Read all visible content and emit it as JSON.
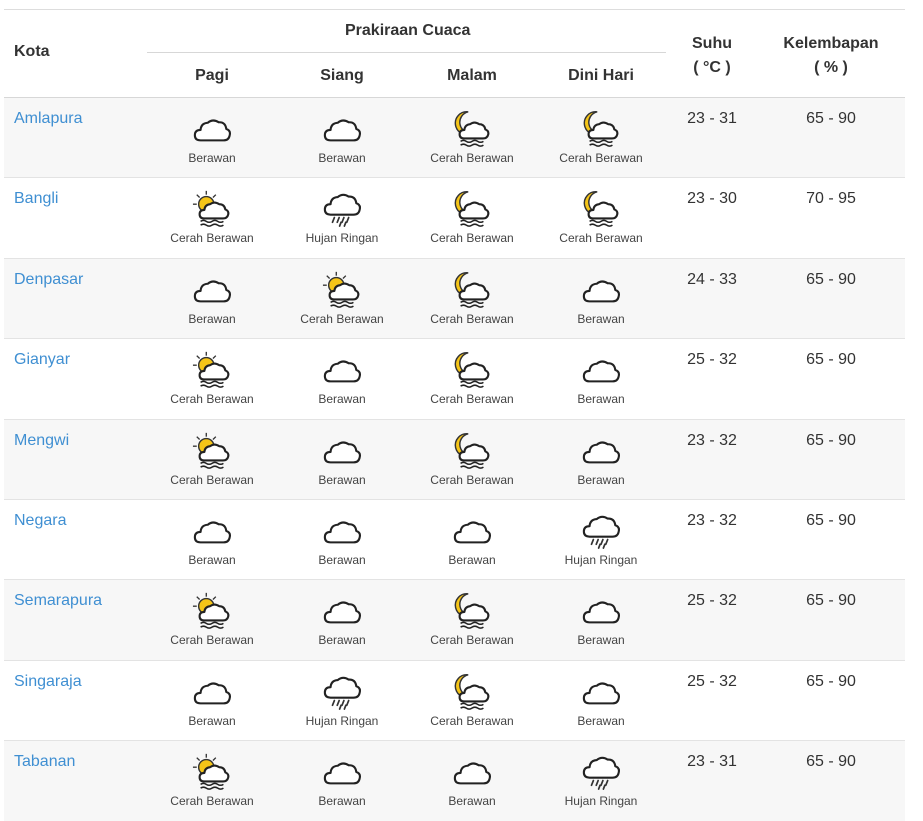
{
  "header": {
    "kota": "Kota",
    "prakiraan": "Prakiraan Cuaca",
    "periods": [
      "Pagi",
      "Siang",
      "Malam",
      "Dini Hari"
    ],
    "suhu": "Suhu",
    "suhu_unit": "( °C )",
    "kelembapan": "Kelembapan",
    "kelembapan_unit": "( % )"
  },
  "rows": [
    {
      "city": "Amlapura",
      "temp": "23 - 31",
      "hum": "65 - 90",
      "forecast": [
        {
          "label": "Berawan",
          "icon": "cloudy-icon"
        },
        {
          "label": "Berawan",
          "icon": "cloudy-icon"
        },
        {
          "label": "Cerah Berawan",
          "icon": "partly-cloudy-night-icon"
        },
        {
          "label": "Cerah Berawan",
          "icon": "partly-cloudy-night-icon"
        }
      ]
    },
    {
      "city": "Bangli",
      "temp": "23 - 30",
      "hum": "70 - 95",
      "forecast": [
        {
          "label": "Cerah Berawan",
          "icon": "partly-cloudy-day-icon"
        },
        {
          "label": "Hujan Ringan",
          "icon": "light-rain-icon"
        },
        {
          "label": "Cerah Berawan",
          "icon": "partly-cloudy-night-icon"
        },
        {
          "label": "Cerah Berawan",
          "icon": "partly-cloudy-night-icon"
        }
      ]
    },
    {
      "city": "Denpasar",
      "temp": "24 - 33",
      "hum": "65 - 90",
      "forecast": [
        {
          "label": "Berawan",
          "icon": "cloudy-icon"
        },
        {
          "label": "Cerah Berawan",
          "icon": "partly-cloudy-day-icon"
        },
        {
          "label": "Cerah Berawan",
          "icon": "partly-cloudy-night-icon"
        },
        {
          "label": "Berawan",
          "icon": "cloudy-icon"
        }
      ]
    },
    {
      "city": "Gianyar",
      "temp": "25 - 32",
      "hum": "65 - 90",
      "forecast": [
        {
          "label": "Cerah Berawan",
          "icon": "partly-cloudy-day-icon"
        },
        {
          "label": "Berawan",
          "icon": "cloudy-icon"
        },
        {
          "label": "Cerah Berawan",
          "icon": "partly-cloudy-night-icon"
        },
        {
          "label": "Berawan",
          "icon": "cloudy-icon"
        }
      ]
    },
    {
      "city": "Mengwi",
      "temp": "23 - 32",
      "hum": "65 - 90",
      "forecast": [
        {
          "label": "Cerah Berawan",
          "icon": "partly-cloudy-day-icon"
        },
        {
          "label": "Berawan",
          "icon": "cloudy-icon"
        },
        {
          "label": "Cerah Berawan",
          "icon": "partly-cloudy-night-icon"
        },
        {
          "label": "Berawan",
          "icon": "cloudy-icon"
        }
      ]
    },
    {
      "city": "Negara",
      "temp": "23 - 32",
      "hum": "65 - 90",
      "forecast": [
        {
          "label": "Berawan",
          "icon": "cloudy-icon"
        },
        {
          "label": "Berawan",
          "icon": "cloudy-icon"
        },
        {
          "label": "Berawan",
          "icon": "cloudy-icon"
        },
        {
          "label": "Hujan Ringan",
          "icon": "light-rain-icon"
        }
      ]
    },
    {
      "city": "Semarapura",
      "temp": "25 - 32",
      "hum": "65 - 90",
      "forecast": [
        {
          "label": "Cerah Berawan",
          "icon": "partly-cloudy-day-icon"
        },
        {
          "label": "Berawan",
          "icon": "cloudy-icon"
        },
        {
          "label": "Cerah Berawan",
          "icon": "partly-cloudy-night-icon"
        },
        {
          "label": "Berawan",
          "icon": "cloudy-icon"
        }
      ]
    },
    {
      "city": "Singaraja",
      "temp": "25 - 32",
      "hum": "65 - 90",
      "forecast": [
        {
          "label": "Berawan",
          "icon": "cloudy-icon"
        },
        {
          "label": "Hujan Ringan",
          "icon": "light-rain-icon"
        },
        {
          "label": "Cerah Berawan",
          "icon": "partly-cloudy-night-icon"
        },
        {
          "label": "Berawan",
          "icon": "cloudy-icon"
        }
      ]
    },
    {
      "city": "Tabanan",
      "temp": "23 - 31",
      "hum": "65 - 90",
      "forecast": [
        {
          "label": "Cerah Berawan",
          "icon": "partly-cloudy-day-icon"
        },
        {
          "label": "Berawan",
          "icon": "cloudy-icon"
        },
        {
          "label": "Berawan",
          "icon": "cloudy-icon"
        },
        {
          "label": "Hujan Ringan",
          "icon": "light-rain-icon"
        }
      ]
    }
  ]
}
